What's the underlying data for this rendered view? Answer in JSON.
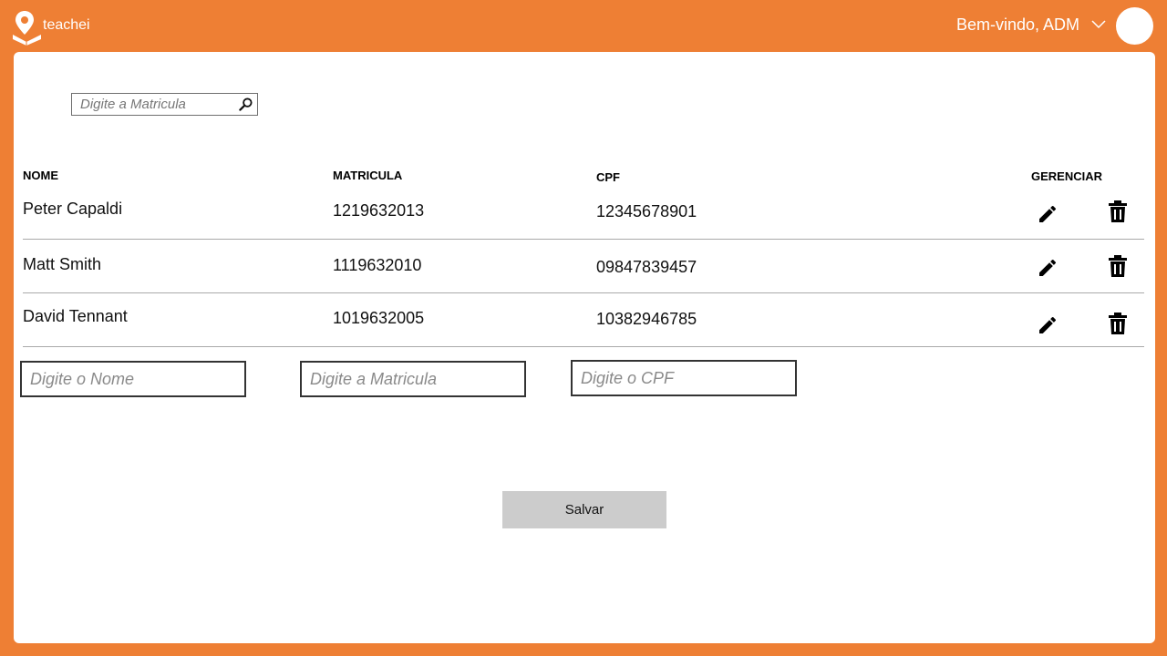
{
  "header": {
    "brand": "teachei",
    "welcome": "Bem-vindo, ADM"
  },
  "search": {
    "placeholder": "Digite a Matricula"
  },
  "table": {
    "columns": {
      "name": "NOME",
      "matricula": "MATRICULA",
      "cpf": "CPF",
      "manage": "GERENCIAR"
    },
    "rows": [
      {
        "name": "Peter Capaldi",
        "matricula": "1219632013",
        "cpf": "12345678901"
      },
      {
        "name": "Matt Smith",
        "matricula": "1119632010",
        "cpf": "09847839457"
      },
      {
        "name": "David Tennant",
        "matricula": "1019632005",
        "cpf": "10382946785"
      }
    ]
  },
  "form": {
    "name_placeholder": "Digite o Nome",
    "matricula_placeholder": "Digite a Matricula",
    "cpf_placeholder": "Digite o CPF",
    "save_label": "Salvar"
  },
  "colors": {
    "accent": "#EE7F34",
    "panel": "#FFFFFF",
    "button": "#CCCCCC"
  },
  "icons": [
    "map-pin-book-logo-icon",
    "chevron-down-icon",
    "search-icon",
    "edit-pencil-icon",
    "trash-icon"
  ]
}
